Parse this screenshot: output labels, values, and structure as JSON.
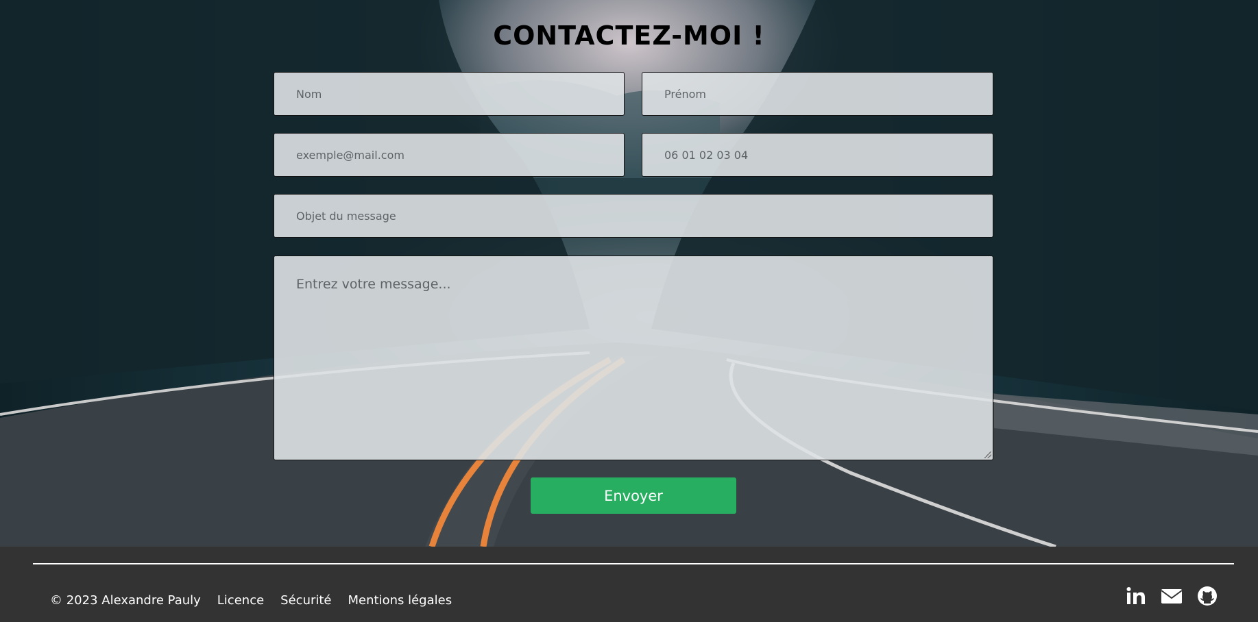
{
  "page": {
    "title": "CONTACTEZ-MOI !"
  },
  "form": {
    "nom_placeholder": "Nom",
    "prenom_placeholder": "Prénom",
    "email_placeholder": "exemple@mail.com",
    "phone_placeholder": "06 01 02 03 04",
    "subject_placeholder": "Objet du message",
    "message_placeholder": "Entrez votre message...",
    "submit_label": "Envoyer"
  },
  "footer": {
    "copyright": "© 2023 Alexandre Pauly",
    "links": [
      "Licence",
      "Sécurité",
      "Mentions légales"
    ],
    "social_icons": [
      "linkedin-icon",
      "mail-icon",
      "github-icon"
    ]
  },
  "colors": {
    "submit_button": "#27ae60",
    "footer_bg": "#333333",
    "field_bg": "#dee2e4"
  }
}
